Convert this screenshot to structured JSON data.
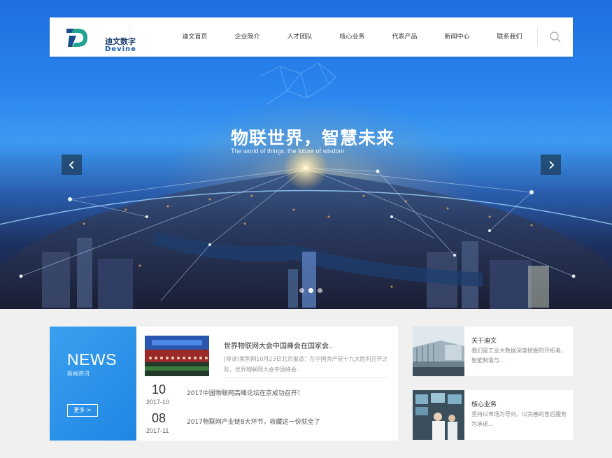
{
  "brand": {
    "name_cn": "迪文数字",
    "name_en": "Devine"
  },
  "nav": {
    "items": [
      {
        "label": "迪文首页"
      },
      {
        "label": "企业简介"
      },
      {
        "label": "人才团队"
      },
      {
        "label": "核心业务"
      },
      {
        "label": "代表产品"
      },
      {
        "label": "新闻中心"
      },
      {
        "label": "联系我们"
      }
    ],
    "search_icon": "search-icon"
  },
  "hero": {
    "title": "物联世界，智慧未来",
    "subtitle": "The world of things, the future of wisdom",
    "slide_count": 3,
    "active_slide": 1
  },
  "news": {
    "heading": "NEWS",
    "subheading": "新闻资讯",
    "more_label": "更多 >",
    "featured": {
      "title": "世界物联网大会中国峰会在国家会..",
      "desc": "[导读]紫荆网10月23日北京报道：在中国共产党十九大胜利召开之际，世界物联网大会中国峰会.."
    },
    "items": [
      {
        "day": "10",
        "ym": "2017-10",
        "title": "2017中国物联网高峰论坛在京成功召开！"
      },
      {
        "day": "08",
        "ym": "2017-11",
        "title": "2017物联网产业链8大环节，收藏这一份就全了"
      }
    ]
  },
  "cards": [
    {
      "title": "关于迪文",
      "desc": "我们是工业大数据深度挖掘的开拓者，智能制造与..."
    },
    {
      "title": "核心业务",
      "desc": "坚持以市场为导向，以完善的售后服务为承诺..."
    }
  ],
  "colors": {
    "accent": "#2a8de6",
    "nav_text": "#333333"
  }
}
